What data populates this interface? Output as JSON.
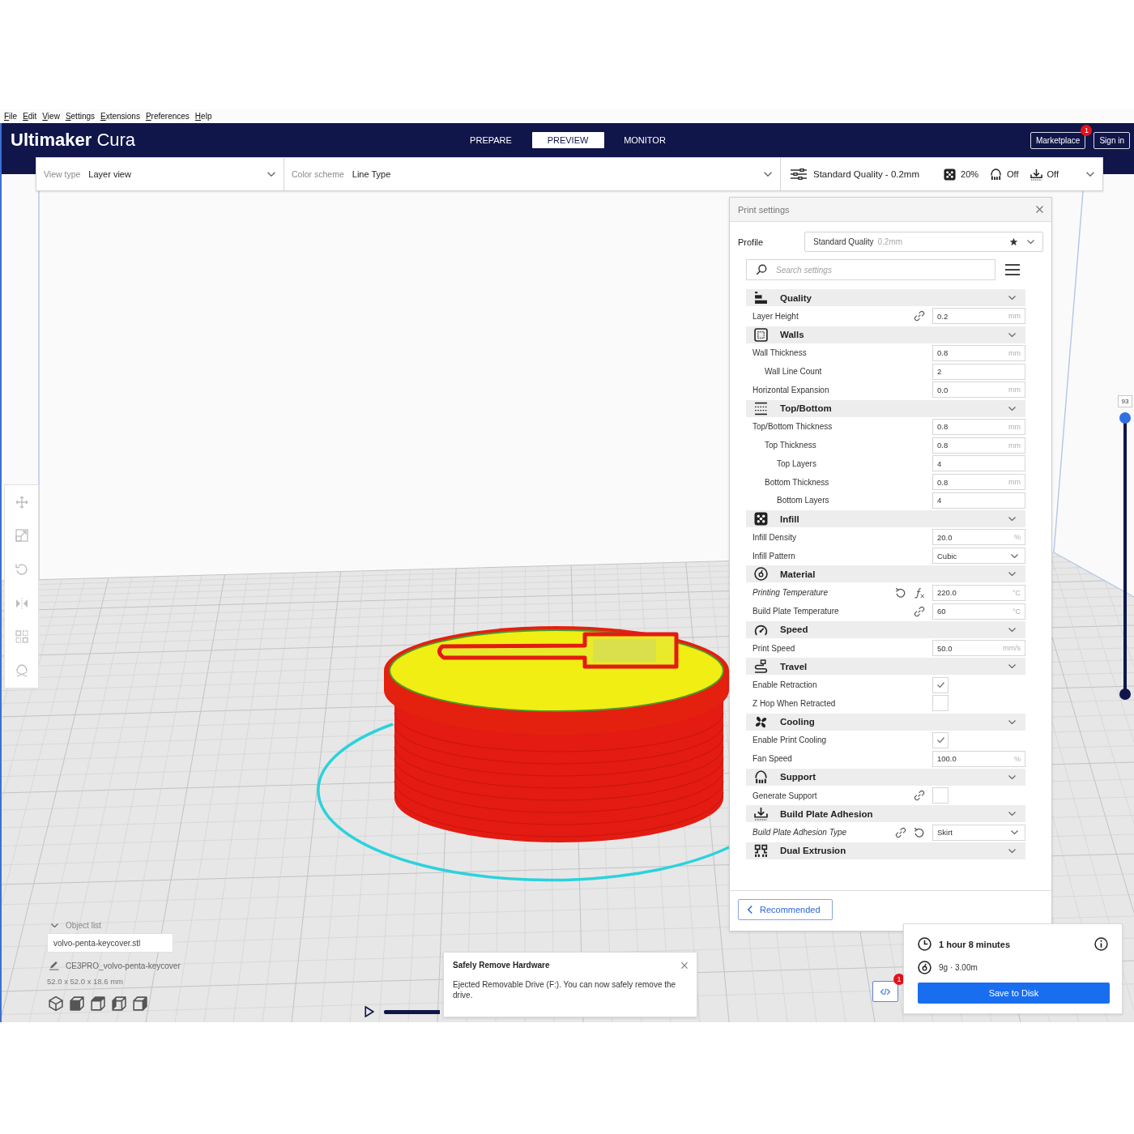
{
  "menu_bar": [
    "File",
    "Edit",
    "View",
    "Settings",
    "Extensions",
    "Preferences",
    "Help"
  ],
  "header": {
    "logo": "**Ultimaker** Cura",
    "tabs": [
      {
        "label": "PREPARE",
        "selected": false
      },
      {
        "label": "PREVIEW",
        "selected": true
      },
      {
        "label": "MONITOR",
        "selected": false
      }
    ],
    "marketplace": {
      "label": "Marketplace",
      "badge": "1"
    },
    "sign_in": "Sign in"
  },
  "toolbar": {
    "view_type": {
      "label": "View type",
      "value": "Layer view"
    },
    "color_scheme": {
      "label": "Color scheme",
      "value": "Line Type"
    },
    "print_setup": {
      "profile": "Standard Quality - 0.2mm",
      "infill": "20%",
      "support": "Off",
      "adhesion": "Off"
    }
  },
  "left_toolbar": {
    "tools": [
      {
        "kind": "move",
        "disabled": true
      },
      {
        "kind": "scale",
        "disabled": true
      },
      {
        "kind": "rotate",
        "disabled": true
      },
      {
        "kind": "mirror",
        "disabled": true
      },
      {
        "kind": "per_model",
        "disabled": true
      },
      {
        "kind": "support_blocker",
        "disabled": true
      }
    ]
  },
  "print_settings": {
    "title": "Print settings",
    "profile": {
      "label": "Profile",
      "value": "Standard Quality",
      "hint": "0.2mm"
    },
    "search": {
      "placeholder": "Search settings"
    },
    "sections": [
      {
        "title": "Quality",
        "kind": "quality",
        "settings": [
          {
            "label": "Layer Height",
            "kind": "number",
            "value": "0.2",
            "unit": "mm",
            "linked": true,
            "overridden": false,
            "formula": false
          }
        ]
      },
      {
        "title": "Walls",
        "kind": "walls",
        "settings": [
          {
            "label": "Wall Thickness",
            "kind": "number",
            "value": "0.8",
            "unit": "mm",
            "linked": false,
            "overridden": false,
            "formula": false,
            "children": [
              {
                "label": "Wall Line Count",
                "kind": "number",
                "value": "2",
                "linked": false,
                "overridden": false,
                "formula": false
              }
            ]
          },
          {
            "label": "Horizontal Expansion",
            "kind": "number",
            "value": "0.0",
            "unit": "mm",
            "linked": false,
            "overridden": false,
            "formula": false
          }
        ]
      },
      {
        "title": "Top/Bottom",
        "kind": "topbottom",
        "settings": [
          {
            "label": "Top/Bottom Thickness",
            "kind": "number",
            "value": "0.8",
            "unit": "mm",
            "linked": false,
            "overridden": false,
            "formula": false,
            "children": [
              {
                "label": "Top Thickness",
                "kind": "number",
                "value": "0.8",
                "unit": "mm",
                "linked": false,
                "overridden": false,
                "formula": false,
                "children": [
                  {
                    "label": "Top Layers",
                    "kind": "number",
                    "value": "4",
                    "linked": false,
                    "overridden": false,
                    "formula": false
                  }
                ]
              },
              {
                "label": "Bottom Thickness",
                "kind": "number",
                "value": "0.8",
                "unit": "mm",
                "linked": false,
                "overridden": false,
                "formula": false,
                "children": [
                  {
                    "label": "Bottom Layers",
                    "kind": "number",
                    "value": "4",
                    "linked": false,
                    "overridden": false,
                    "formula": false
                  }
                ]
              }
            ]
          }
        ]
      },
      {
        "title": "Infill",
        "kind": "infill",
        "settings": [
          {
            "label": "Infill Density",
            "kind": "number",
            "value": "20.0",
            "unit": "%",
            "linked": false,
            "overridden": false,
            "formula": false
          },
          {
            "label": "Infill Pattern",
            "kind": "dropdown",
            "value": "Cubic",
            "linked": false,
            "overridden": false,
            "formula": false
          }
        ]
      },
      {
        "title": "Material",
        "kind": "material",
        "settings": [
          {
            "label": "Printing Temperature",
            "kind": "number",
            "value": "220.0",
            "unit": "°C",
            "linked": false,
            "overridden": true,
            "formula": true
          },
          {
            "label": "Build Plate Temperature",
            "kind": "number",
            "value": "60",
            "unit": "°C",
            "linked": true,
            "overridden": false,
            "formula": false
          }
        ]
      },
      {
        "title": "Speed",
        "kind": "speed",
        "settings": [
          {
            "label": "Print Speed",
            "kind": "number",
            "value": "50.0",
            "unit": "mm/s",
            "linked": false,
            "overridden": false,
            "formula": false
          }
        ]
      },
      {
        "title": "Travel",
        "kind": "travel",
        "settings": [
          {
            "label": "Enable Retraction",
            "kind": "checkbox",
            "checked": true,
            "linked": false,
            "overridden": false,
            "formula": false
          },
          {
            "label": "Z Hop When Retracted",
            "kind": "checkbox",
            "checked": false,
            "linked": false,
            "overridden": false,
            "formula": false
          }
        ]
      },
      {
        "title": "Cooling",
        "kind": "cooling",
        "settings": [
          {
            "label": "Enable Print Cooling",
            "kind": "checkbox",
            "checked": true,
            "linked": false,
            "overridden": false,
            "formula": false
          },
          {
            "label": "Fan Speed",
            "kind": "number",
            "value": "100.0",
            "unit": "%",
            "linked": false,
            "overridden": false,
            "formula": false
          }
        ]
      },
      {
        "title": "Support",
        "kind": "support",
        "settings": [
          {
            "label": "Generate Support",
            "kind": "checkbox",
            "checked": false,
            "linked": true,
            "overridden": false,
            "formula": false
          }
        ]
      },
      {
        "title": "Build Plate Adhesion",
        "kind": "adhesion",
        "settings": [
          {
            "label": "Build Plate Adhesion Type",
            "kind": "dropdown",
            "value": "Skirt",
            "linked": true,
            "overridden": true,
            "formula": false
          }
        ]
      },
      {
        "title": "Dual Extrusion",
        "kind": "dual"
      }
    ],
    "footer_button": "Recommended"
  },
  "layer_slider": {
    "layer": "93",
    "level": 1
  },
  "object_list": {
    "title": "Object list",
    "items": [
      "volvo-penta-keycover.stl"
    ],
    "job_name": "CE3PRO_volvo-penta-keycover",
    "dimensions": "52.0 x 52.0 x 18.6 mm",
    "views": [
      {
        "kind": "perspective"
      },
      {
        "kind": "front"
      },
      {
        "kind": "top"
      },
      {
        "kind": "left"
      },
      {
        "kind": "right"
      }
    ]
  },
  "notification": {
    "title": "Safely Remove Hardware",
    "message": "Ejected Removable Drive (F:). You can now safely remove the drive."
  },
  "output_device": {
    "badge": "1"
  },
  "print_info": {
    "time": "1 hour 8 minutes",
    "material": "9g · 3.00m",
    "save_button": "Save to Disk"
  }
}
